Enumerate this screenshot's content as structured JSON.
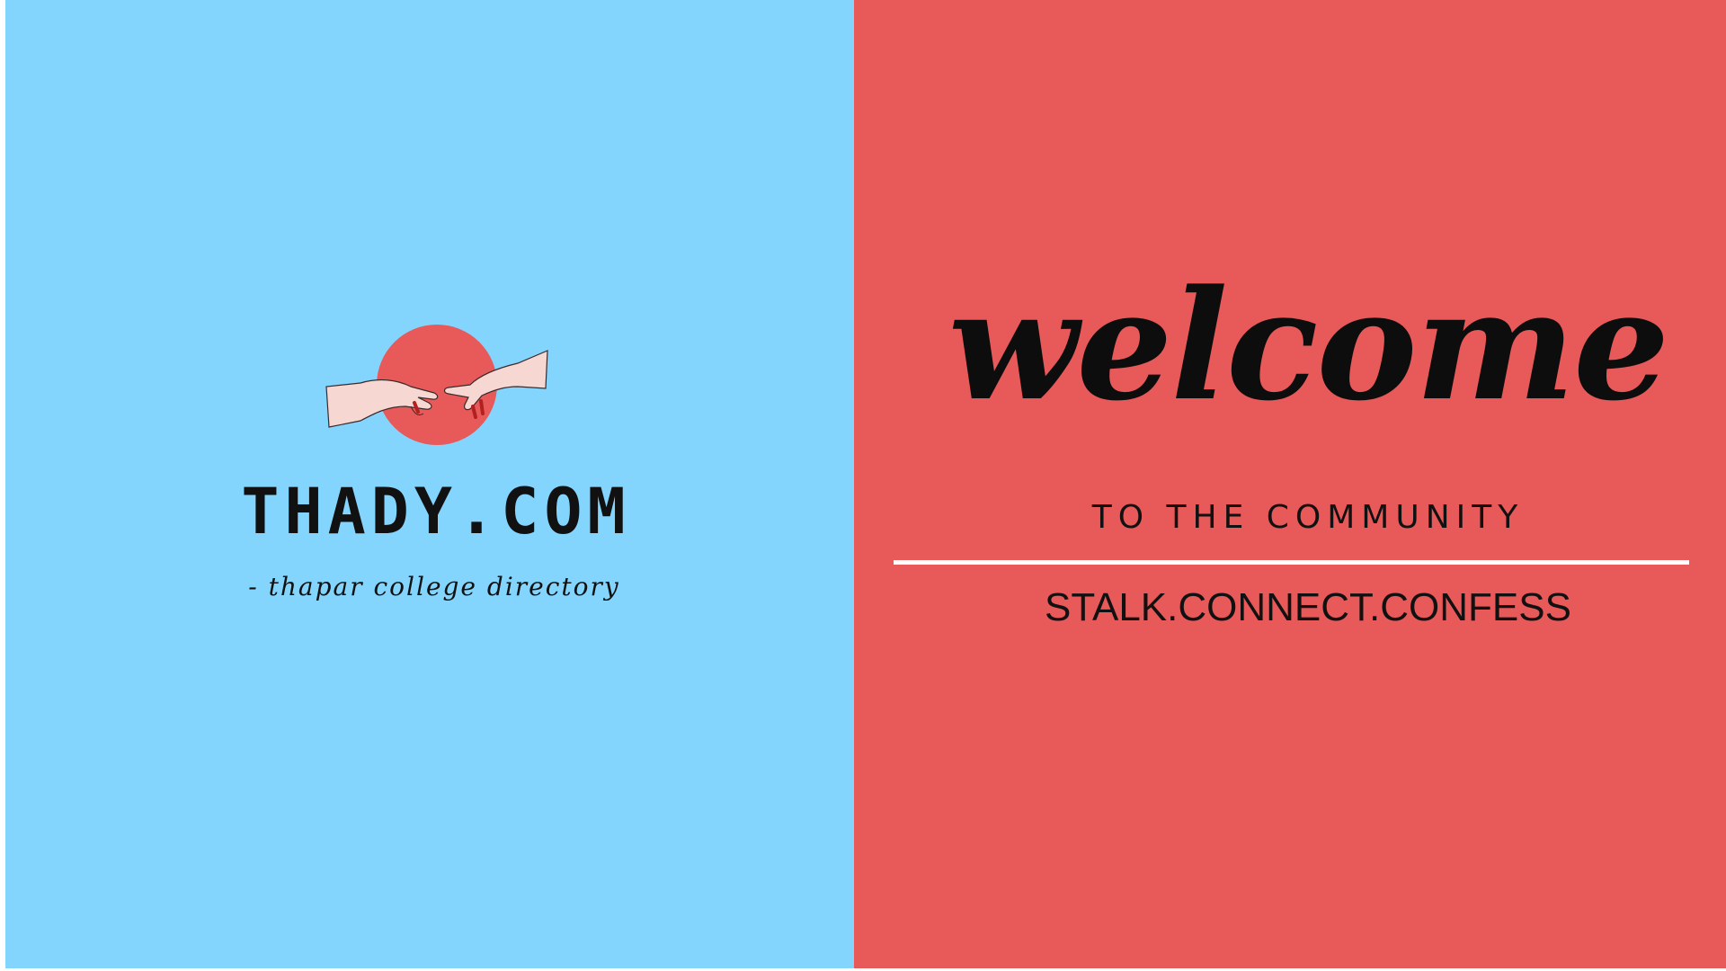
{
  "left_panel": {
    "background": "#84d5fe",
    "logo": {
      "icon": "hands-reaching-logo-icon",
      "circle_color": "#e85959",
      "brand_name": "THADY.COM",
      "tagline": "- thapar college directory"
    }
  },
  "right_panel": {
    "background": "#e85959",
    "heading": "welcome",
    "subheading": "TO THE COMMUNITY",
    "slogan": "STALK.CONNECT.CONFESS"
  }
}
